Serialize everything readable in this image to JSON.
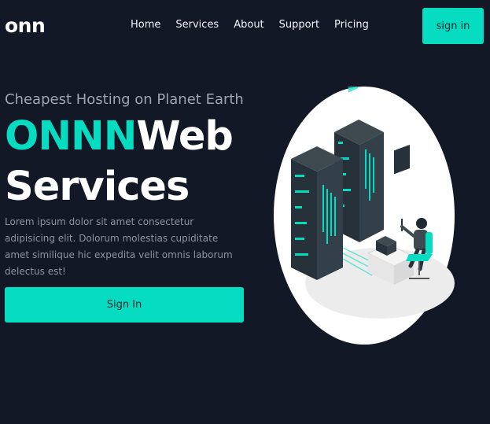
{
  "header": {
    "logo": "onn",
    "nav": [
      "Home",
      "Services",
      "About",
      "Support",
      "Pricing"
    ],
    "signin_label": "sign in"
  },
  "hero": {
    "tagline": "Cheapest Hosting on Planet Earth",
    "title_accent": "ONNN",
    "title_rest": "Web",
    "title_line2": "Services",
    "description": "Lorem ipsum dolor sit amet consectetur adipisicing elit. Dolorum molestias cupiditate amet similique hic expedita velit omnis laborum delectus est!",
    "cta_label": "Sign In"
  },
  "colors": {
    "background": "#131826",
    "accent": "#06dcc2",
    "text": "#ffffff",
    "muted": "#8c93a1"
  },
  "icons": {
    "illustration": "server-rack-engineer-illustration"
  }
}
